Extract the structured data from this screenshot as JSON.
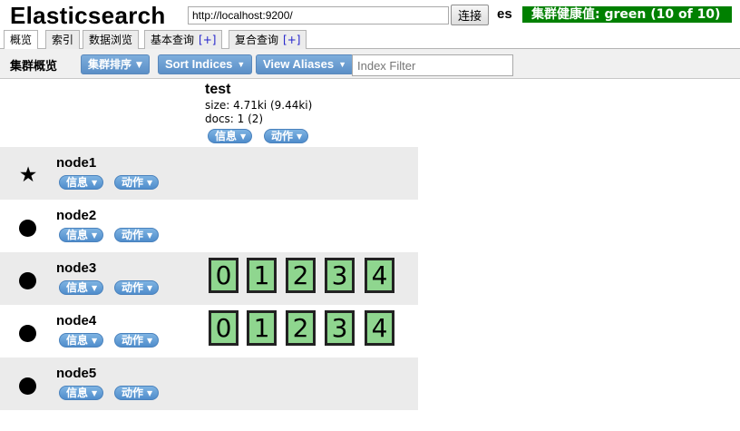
{
  "header": {
    "app_title": "Elasticsearch",
    "url_value": "http://localhost:9200/",
    "connect_label": "连接",
    "cluster_name": "es",
    "health_text": "集群健康值: green (10 of 10)",
    "health_color": "#008000"
  },
  "tabs": [
    {
      "label": "概览",
      "active": true
    },
    {
      "label": "索引"
    },
    {
      "label": "数据浏览"
    },
    {
      "label": "基本查询",
      "plus": "[+]"
    },
    {
      "label": "复合查询",
      "plus": "[+]"
    }
  ],
  "toolbar": {
    "title": "集群概览",
    "sort_cluster_label": "集群排序",
    "sort_indices_label": "Sort Indices",
    "view_aliases_label": "View Aliases",
    "filter_placeholder": "Index Filter"
  },
  "index": {
    "name": "test",
    "size": "size: 4.71ki (9.44ki)",
    "docs": "docs: 1 (2)",
    "info_label": "信息",
    "action_label": "动作"
  },
  "nodes": [
    {
      "name": "node1",
      "icon": "star-icon",
      "master": true,
      "shards": []
    },
    {
      "name": "node2",
      "icon": "dot-icon",
      "shards": []
    },
    {
      "name": "node3",
      "icon": "dot-icon",
      "shards": [
        "0",
        "1",
        "2",
        "3",
        "4"
      ]
    },
    {
      "name": "node4",
      "icon": "dot-icon",
      "shards": [
        "0",
        "1",
        "2",
        "3",
        "4"
      ]
    },
    {
      "name": "node5",
      "icon": "dot-icon",
      "shards": []
    }
  ],
  "node_buttons": {
    "info_label": "信息",
    "action_label": "动作"
  },
  "colors": {
    "accent_button": "#5b8fc7",
    "shard_fill": "#8fd68f",
    "row_shade": "#ebebeb"
  }
}
